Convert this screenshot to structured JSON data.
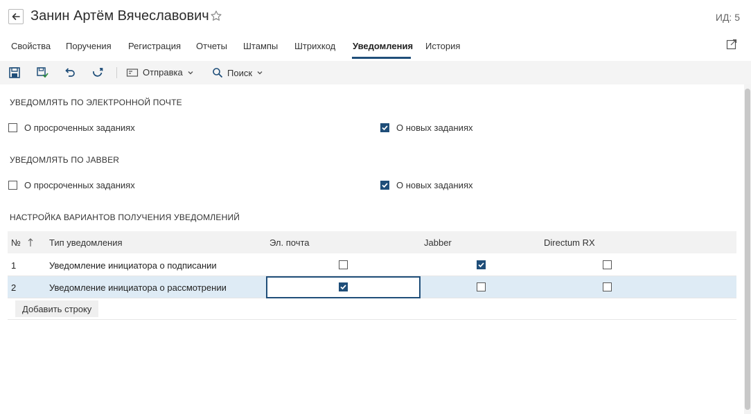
{
  "header": {
    "title": "Занин Артём Вячеславович",
    "id_label": "ИД: 5"
  },
  "tabs": [
    {
      "label": "Свойства",
      "active": false
    },
    {
      "label": "Поручения",
      "active": false
    },
    {
      "label": "Регистрация",
      "active": false
    },
    {
      "label": "Отчеты",
      "active": false
    },
    {
      "label": "Штампы",
      "active": false
    },
    {
      "label": "Штрихкод",
      "active": false
    },
    {
      "label": "Уведомления",
      "active": true
    },
    {
      "label": "История",
      "active": false
    }
  ],
  "toolbar": {
    "send_label": "Отправка",
    "search_label": "Поиск"
  },
  "email_section": {
    "title": "УВЕДОМЛЯТЬ ПО ЭЛЕКТРОННОЙ ПОЧТЕ",
    "overdue_label": "О просроченных заданиях",
    "overdue_checked": false,
    "new_label": "О новых заданиях",
    "new_checked": true
  },
  "jabber_section": {
    "title": "УВЕДОМЛЯТЬ ПО JABBER",
    "overdue_label": "О просроченных заданиях",
    "overdue_checked": false,
    "new_label": "О новых заданиях",
    "new_checked": true
  },
  "settings_section": {
    "title": "НАСТРОЙКА ВАРИАНТОВ ПОЛУЧЕНИЯ УВЕДОМЛЕНИЙ",
    "columns": {
      "num": "№",
      "type": "Тип уведомления",
      "email": "Эл. почта",
      "jabber": "Jabber",
      "directum": "Directum RX"
    },
    "rows": [
      {
        "num": "1",
        "type": "Уведомление инициатора о подписании",
        "email": false,
        "jabber": true,
        "directum": false
      },
      {
        "num": "2",
        "type": "Уведомление инициатора о рассмотрении",
        "email": true,
        "jabber": false,
        "directum": false
      }
    ],
    "add_row_label": "Добавить строку"
  },
  "colors": {
    "accent": "#1f4e79",
    "selected_row": "#deebf5",
    "toolbar_bg": "#f4f4f4"
  }
}
